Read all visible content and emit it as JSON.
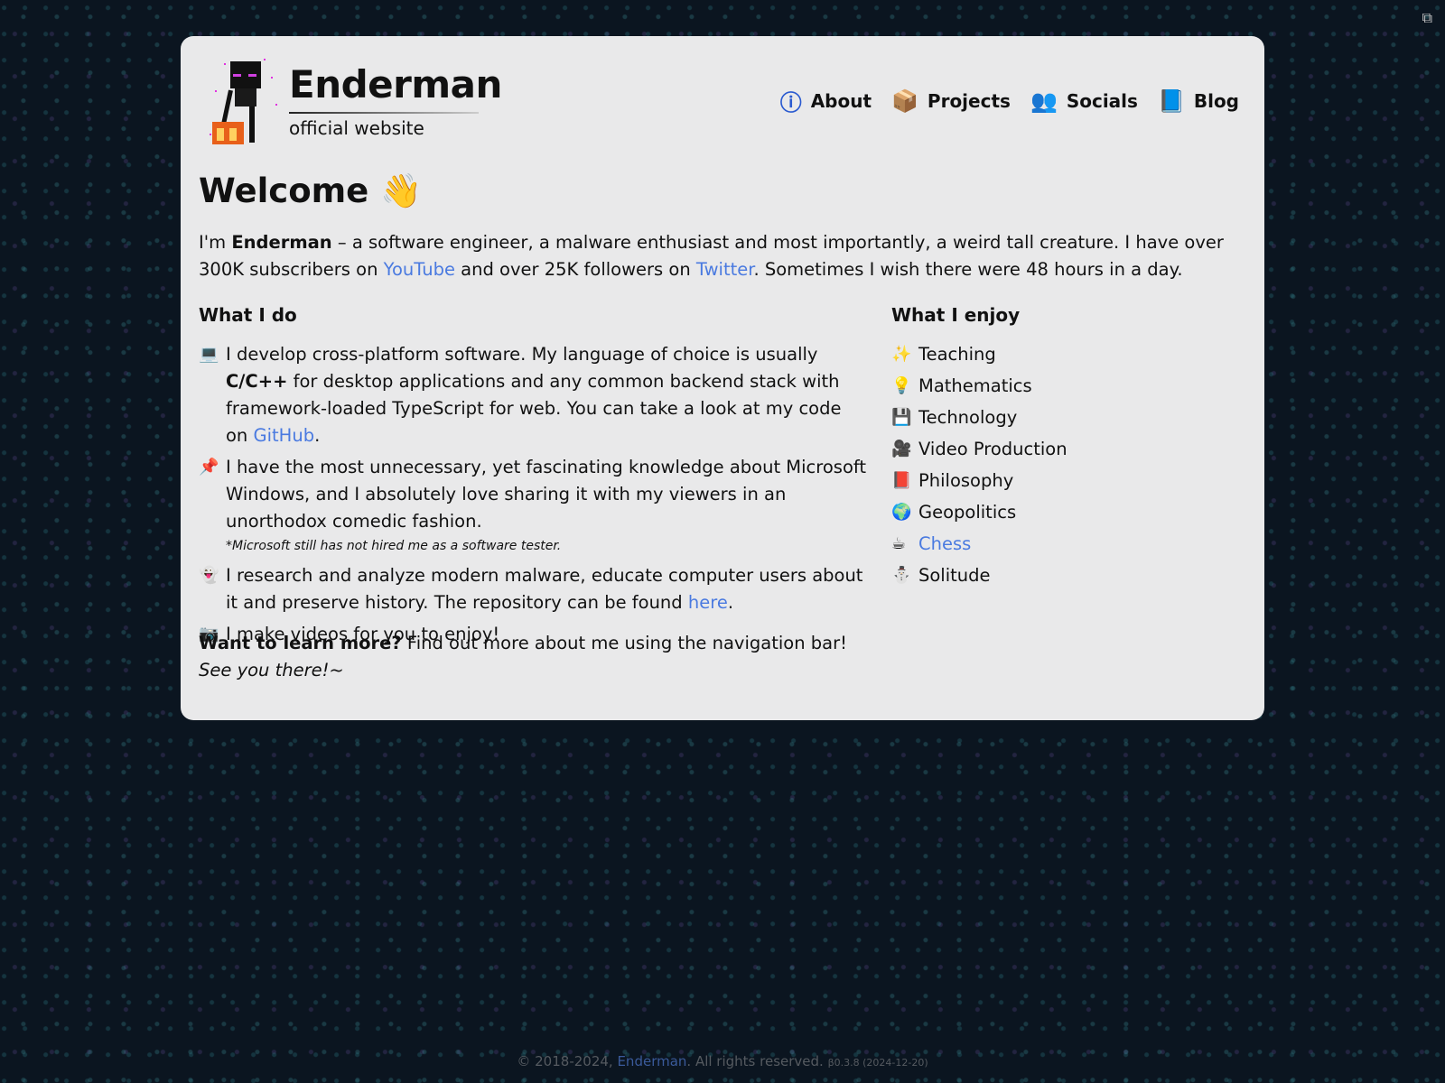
{
  "header": {
    "title": "Enderman",
    "subtitle": "official website"
  },
  "nav": [
    {
      "label": "About",
      "icon": "info-icon"
    },
    {
      "label": "Projects",
      "icon": "package-icon"
    },
    {
      "label": "Socials",
      "icon": "people-icon"
    },
    {
      "label": "Blog",
      "icon": "book-icon"
    }
  ],
  "welcome": {
    "title": "Welcome",
    "emoji": "👋"
  },
  "intro": {
    "p1": "I'm ",
    "name": "Enderman",
    "p2": " – a software engineer, a malware enthusiast and most importantly, a weird tall creature. I have over 300K subscribers on ",
    "youtube": "YouTube",
    "p3": " and over 25K followers on ",
    "twitter": "Twitter",
    "p4": ". Sometimes I wish there were 48 hours in a day."
  },
  "what_i_do": {
    "title": "What I do",
    "i1": {
      "emoji": "💻",
      "a": "I develop cross-platform software. My language of choice is usually ",
      "b": "C/C++",
      "c": " for desktop applications and any common backend stack with framework-loaded TypeScript for web. You can take a look at my code on ",
      "link": "GitHub",
      "d": "."
    },
    "i2": {
      "emoji": "📌",
      "text": "I have the most unnecessary, yet fascinating knowledge about Microsoft Windows, and I absolutely love sharing it with my viewers in an unorthodox comedic fashion.",
      "note": "*Microsoft still has not hired me as a software tester."
    },
    "i3": {
      "emoji": "👻",
      "a": "I research and analyze modern malware, educate computer users about it and preserve history. The repository can be found ",
      "link": "here",
      "b": "."
    },
    "i4": {
      "emoji": "📷",
      "text": "I make videos for you to enjoy!"
    }
  },
  "what_i_enjoy": {
    "title": "What I enjoy",
    "items": [
      {
        "emoji": "✨",
        "label": "Teaching"
      },
      {
        "emoji": "💡",
        "label": "Mathematics"
      },
      {
        "emoji": "💾",
        "label": "Technology"
      },
      {
        "emoji": "🎥",
        "label": "Video Production"
      },
      {
        "emoji": "📕",
        "label": "Philosophy"
      },
      {
        "emoji": "🌍",
        "label": "Geopolitics"
      },
      {
        "emoji": "☕",
        "label": "Chess",
        "link": true
      },
      {
        "emoji": "⛄",
        "label": "Solitude"
      }
    ]
  },
  "outro": {
    "bold": "Want to learn more?",
    "text": " Find out more about me using the navigation bar!",
    "italic": "See you there!~"
  },
  "footer": {
    "copy": "© 2018-2024, ",
    "link": "Enderman",
    "rest": ". All rights reserved.",
    "version": "β0.3.8 (2024-12-20)"
  },
  "colors": {
    "link": "#4a7ae0",
    "card": "#e9e9ea"
  }
}
